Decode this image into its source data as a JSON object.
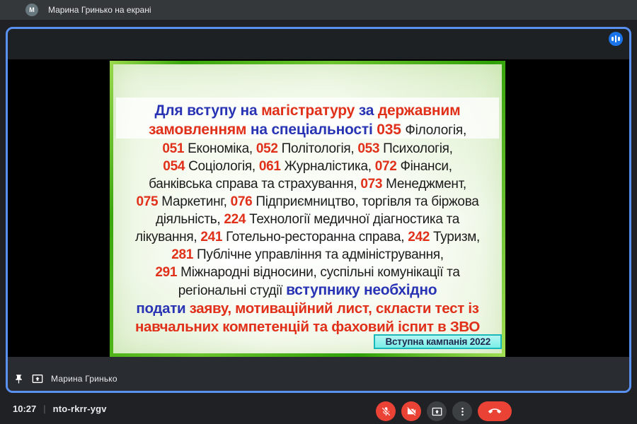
{
  "theme": {
    "page_bg": "#202124",
    "topbar_bg": "#35383b",
    "tile_border": "#5a90f0",
    "danger_red": "#ea4335",
    "control_dark": "#3c4043",
    "audio_blue": "#1a73e8"
  },
  "header": {
    "avatar_letter": "M",
    "presenting_label": "Марина Гринько на екрані"
  },
  "tile": {
    "presenter_name": "Марина Гринько",
    "icons": [
      "pin-icon",
      "popout-icon",
      "audio-indicator-icon"
    ]
  },
  "slide": {
    "badge": "Вступна кампанія 2022",
    "colors": {
      "r": "#e0301a",
      "u": "#2834b4",
      "k": "#1c1c1c"
    },
    "lines": [
      {
        "style": "h",
        "seg": [
          {
            "t": "Для вступу на ",
            "c": "u",
            "b": 1
          },
          {
            "t": "магістратуру ",
            "c": "r",
            "b": 1
          },
          {
            "t": "за ",
            "c": "u",
            "b": 1
          },
          {
            "t": "державним",
            "c": "r",
            "b": 1
          }
        ]
      },
      {
        "style": "h",
        "seg": [
          {
            "t": "замовленням ",
            "c": "r",
            "b": 1
          },
          {
            "t": "на спеціальності ",
            "c": "u",
            "b": 1
          },
          {
            "t": "035 ",
            "c": "r",
            "b": 1
          },
          {
            "t": "Філологія,",
            "c": "k",
            "b": 0,
            "s": 19
          }
        ]
      },
      {
        "style": "b",
        "seg": [
          {
            "t": "051 ",
            "c": "r",
            "b": 1
          },
          {
            "t": "Економіка,  ",
            "c": "k",
            "b": 0
          },
          {
            "t": "052 ",
            "c": "r",
            "b": 1
          },
          {
            "t": "Політологія, ",
            "c": "k",
            "b": 0
          },
          {
            "t": "053 ",
            "c": "r",
            "b": 1
          },
          {
            "t": "Психологія,",
            "c": "k",
            "b": 0
          }
        ]
      },
      {
        "style": "b",
        "seg": [
          {
            "t": "054 ",
            "c": "r",
            "b": 1
          },
          {
            "t": "Соціологія, ",
            "c": "k",
            "b": 0
          },
          {
            "t": "061 ",
            "c": "r",
            "b": 1
          },
          {
            "t": "Журналістика, ",
            "c": "k",
            "b": 0
          },
          {
            "t": "072 ",
            "c": "r",
            "b": 1
          },
          {
            "t": "Фінанси,",
            "c": "k",
            "b": 0
          }
        ]
      },
      {
        "style": "b",
        "seg": [
          {
            "t": "банківська справа та страхування, ",
            "c": "k",
            "b": 0
          },
          {
            "t": "073 ",
            "c": "r",
            "b": 1
          },
          {
            "t": "Менеджмент,",
            "c": "k",
            "b": 0
          }
        ]
      },
      {
        "style": "b",
        "seg": [
          {
            "t": "075 ",
            "c": "r",
            "b": 1
          },
          {
            "t": "Маркетинг, ",
            "c": "k",
            "b": 0
          },
          {
            "t": "076 ",
            "c": "r",
            "b": 1
          },
          {
            "t": "Підприємництво, торгівля та біржова",
            "c": "k",
            "b": 0
          }
        ]
      },
      {
        "style": "b",
        "seg": [
          {
            "t": "діяльність, ",
            "c": "k",
            "b": 0
          },
          {
            "t": "224 ",
            "c": "r",
            "b": 1
          },
          {
            "t": "Технології медичної діагностика та",
            "c": "k",
            "b": 0
          }
        ]
      },
      {
        "style": "b",
        "seg": [
          {
            "t": "лікування, ",
            "c": "k",
            "b": 0
          },
          {
            "t": "241 ",
            "c": "r",
            "b": 1
          },
          {
            "t": "Готельно-ресторанна справа, ",
            "c": "k",
            "b": 0
          },
          {
            "t": "242 ",
            "c": "r",
            "b": 1
          },
          {
            "t": "Туризм,",
            "c": "k",
            "b": 0
          }
        ]
      },
      {
        "style": "b",
        "seg": [
          {
            "t": "281 ",
            "c": "r",
            "b": 1
          },
          {
            "t": "Публічне управління та адміністрування,",
            "c": "k",
            "b": 0
          }
        ]
      },
      {
        "style": "b",
        "seg": [
          {
            "t": "291 ",
            "c": "r",
            "b": 1
          },
          {
            "t": "Міжнародні відносини, суспільні комунікації та",
            "c": "k",
            "b": 0
          }
        ]
      },
      {
        "style": "b",
        "seg": [
          {
            "t": "регіональні студії ",
            "c": "k",
            "b": 0
          },
          {
            "t": "вступнику необхідно",
            "c": "u",
            "b": 1,
            "s": 21
          }
        ]
      },
      {
        "style": "e",
        "seg": [
          {
            "t": "подати ",
            "c": "u",
            "b": 1
          },
          {
            "t": "заяву, мотиваційний лист, скласти тест із",
            "c": "r",
            "b": 1
          }
        ]
      },
      {
        "style": "e",
        "seg": [
          {
            "t": "навчальних компетенцій та фаховий іспит в ЗВО",
            "c": "r",
            "b": 1
          }
        ]
      }
    ]
  },
  "footer": {
    "time": "10:27",
    "separator": "|",
    "meeting_code": "nto-rkrr-ygv",
    "controls": [
      {
        "icon": "mic-off-icon",
        "style": "danger"
      },
      {
        "icon": "camera-off-icon",
        "style": "danger"
      },
      {
        "icon": "present-icon",
        "style": "neutral"
      },
      {
        "icon": "more-options-icon",
        "style": "neutral"
      },
      {
        "icon": "end-call-icon",
        "style": "danger-pill"
      }
    ]
  }
}
